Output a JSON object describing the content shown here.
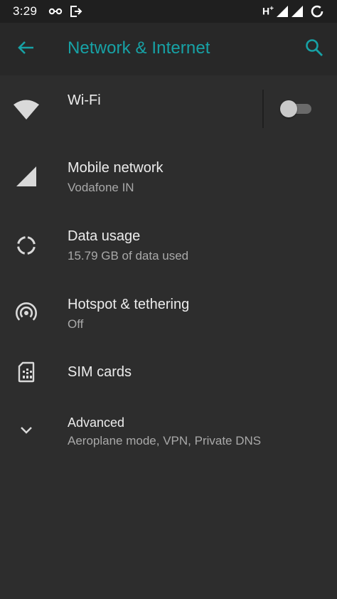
{
  "status_bar": {
    "time": "3:29",
    "network_type": "H",
    "network_plus": "+",
    "icons": [
      "infinity-link-icon",
      "logout-icon",
      "signal-icon",
      "signal-icon",
      "battery-ring-icon"
    ]
  },
  "app_bar": {
    "title": "Network & Internet",
    "back_icon": "arrow-left-icon",
    "search_icon": "search-icon"
  },
  "colors": {
    "accent": "#17a2a6",
    "background": "#2d2d2d",
    "app_bar": "#282828",
    "status_bar": "#1f1f1f",
    "icon": "#d9d9d9"
  },
  "items": [
    {
      "title": "Wi-Fi",
      "subtitle": "",
      "icon": "wifi-icon",
      "toggle": false
    },
    {
      "title": "Mobile network",
      "subtitle": "Vodafone IN",
      "icon": "signal-icon"
    },
    {
      "title": "Data usage",
      "subtitle": "15.79 GB of data used",
      "icon": "data-usage-icon"
    },
    {
      "title": "Hotspot & tethering",
      "subtitle": "Off",
      "icon": "hotspot-icon"
    },
    {
      "title": "SIM cards",
      "subtitle": "",
      "icon": "sim-card-icon"
    },
    {
      "title": "Advanced",
      "subtitle": "Aeroplane mode, VPN, Private DNS",
      "icon": "chevron-down-icon"
    }
  ]
}
